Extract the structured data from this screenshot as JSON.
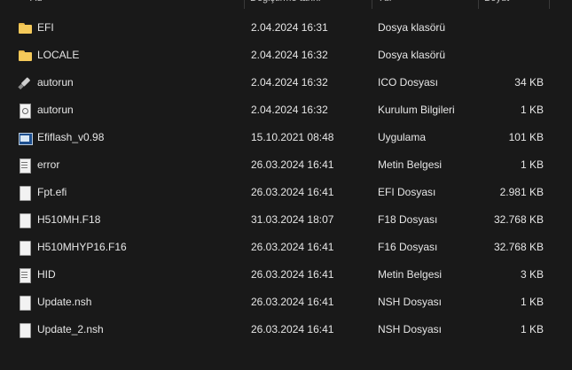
{
  "columns": {
    "name": "Ad",
    "date": "Değiştirme tarihi",
    "type": "Tür",
    "size": "Boyut"
  },
  "files": [
    {
      "name": "EFI",
      "date": "2.04.2024 16:31",
      "type": "Dosya klasörü",
      "size": "",
      "icon": "folder-icon"
    },
    {
      "name": "LOCALE",
      "date": "2.04.2024 16:32",
      "type": "Dosya klasörü",
      "size": "",
      "icon": "folder-icon"
    },
    {
      "name": "autorun",
      "date": "2.04.2024 16:32",
      "type": "ICO Dosyası",
      "size": "34 KB",
      "icon": "usb-icon"
    },
    {
      "name": "autorun",
      "date": "2.04.2024 16:32",
      "type": "Kurulum Bilgileri",
      "size": "1 KB",
      "icon": "settings-icon"
    },
    {
      "name": "Efiflash_v0.98",
      "date": "15.10.2021 08:48",
      "type": "Uygulama",
      "size": "101 KB",
      "icon": "app-icon"
    },
    {
      "name": "error",
      "date": "26.03.2024 16:41",
      "type": "Metin Belgesi",
      "size": "1 KB",
      "icon": "text-icon"
    },
    {
      "name": "Fpt.efi",
      "date": "26.03.2024 16:41",
      "type": "EFI Dosyası",
      "size": "2.981 KB",
      "icon": "doc-icon"
    },
    {
      "name": "H510MH.F18",
      "date": "31.03.2024 18:07",
      "type": "F18 Dosyası",
      "size": "32.768 KB",
      "icon": "doc-icon"
    },
    {
      "name": "H510MHYP16.F16",
      "date": "26.03.2024 16:41",
      "type": "F16 Dosyası",
      "size": "32.768 KB",
      "icon": "doc-icon"
    },
    {
      "name": "HID",
      "date": "26.03.2024 16:41",
      "type": "Metin Belgesi",
      "size": "3 KB",
      "icon": "text-icon"
    },
    {
      "name": "Update.nsh",
      "date": "26.03.2024 16:41",
      "type": "NSH Dosyası",
      "size": "1 KB",
      "icon": "doc-icon"
    },
    {
      "name": "Update_2.nsh",
      "date": "26.03.2024 16:41",
      "type": "NSH Dosyası",
      "size": "1 KB",
      "icon": "doc-icon"
    }
  ]
}
